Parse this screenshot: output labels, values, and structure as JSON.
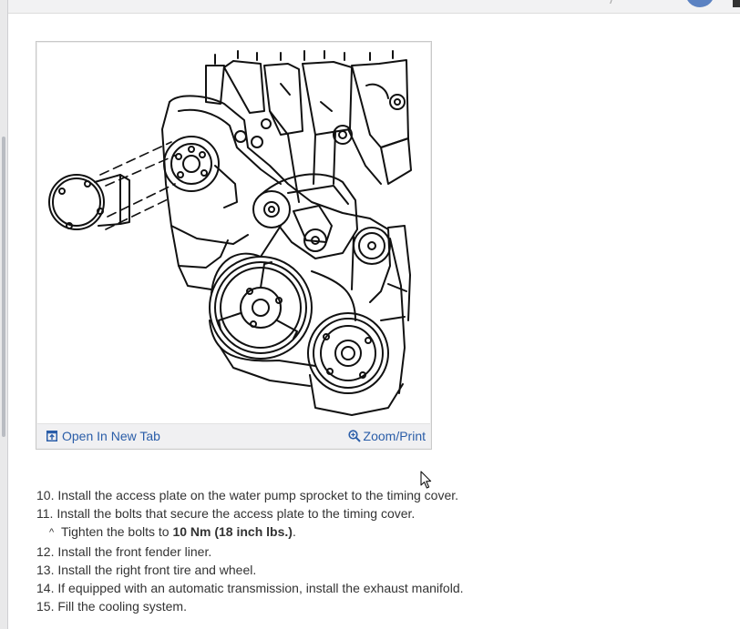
{
  "figure": {
    "open_label": "Open In New Tab",
    "zoom_label": "Zoom/Print",
    "link_color": "#2a5da8"
  },
  "steps": [
    {
      "number": "10.",
      "text": "Install the access plate on the water pump sprocket to the timing cover."
    },
    {
      "number": "11.",
      "text": "Install the bolts that secure the access plate to the timing cover."
    },
    {
      "number": "12.",
      "text": "Install the front fender liner."
    },
    {
      "number": "13.",
      "text": "Install the right front tire and wheel."
    },
    {
      "number": "14.",
      "text": "If equipped with an automatic transmission, install the exhaust manifold."
    },
    {
      "number": "15.",
      "text": "Fill the cooling system."
    }
  ],
  "substep": {
    "marker": "^",
    "prefix": "Tighten the bolts to ",
    "torque": "10 Nm (18 inch lbs.)",
    "suffix": "."
  },
  "icons": {
    "open_icon": "open-in-new-tab-icon",
    "zoom_icon": "magnifier-plus-icon",
    "cursor": "mouse-pointer-icon"
  }
}
